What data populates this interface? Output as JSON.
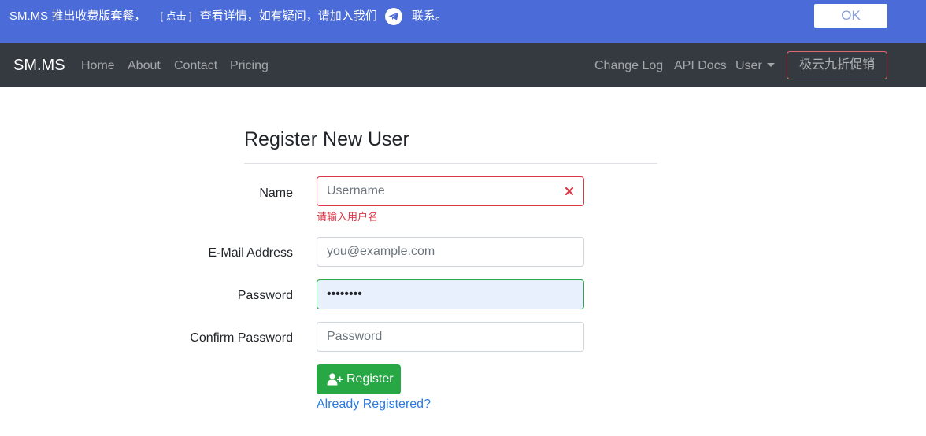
{
  "banner": {
    "text_before": "SM.MS 推出收费版套餐，",
    "link_label": "[ 点击 ]",
    "text_after": "查看详情，如有疑问，请加入我们",
    "text_end": "联系。",
    "ok_label": "OK",
    "background_color": "#4a6bd8"
  },
  "navbar": {
    "brand": "SM.MS",
    "left_links": [
      "Home",
      "About",
      "Contact",
      "Pricing"
    ],
    "right_links": [
      "Change Log",
      "API Docs"
    ],
    "user_menu_label": "User",
    "promo_label": "极云九折促销",
    "background_color": "#343a40"
  },
  "form": {
    "title": "Register New User",
    "name": {
      "label": "Name",
      "placeholder": "Username",
      "error": "请输入用户名"
    },
    "email": {
      "label": "E-Mail Address",
      "placeholder": "you@example.com"
    },
    "password": {
      "label": "Password",
      "masked_value": "••••••••"
    },
    "confirm": {
      "label": "Confirm Password",
      "placeholder": "Password"
    },
    "register_label": "Register",
    "login_link": "Already Registered?"
  },
  "icons": {
    "banner": "telegram-icon",
    "name_field": "invalid-x-icon",
    "register": "user-plus-icon"
  }
}
